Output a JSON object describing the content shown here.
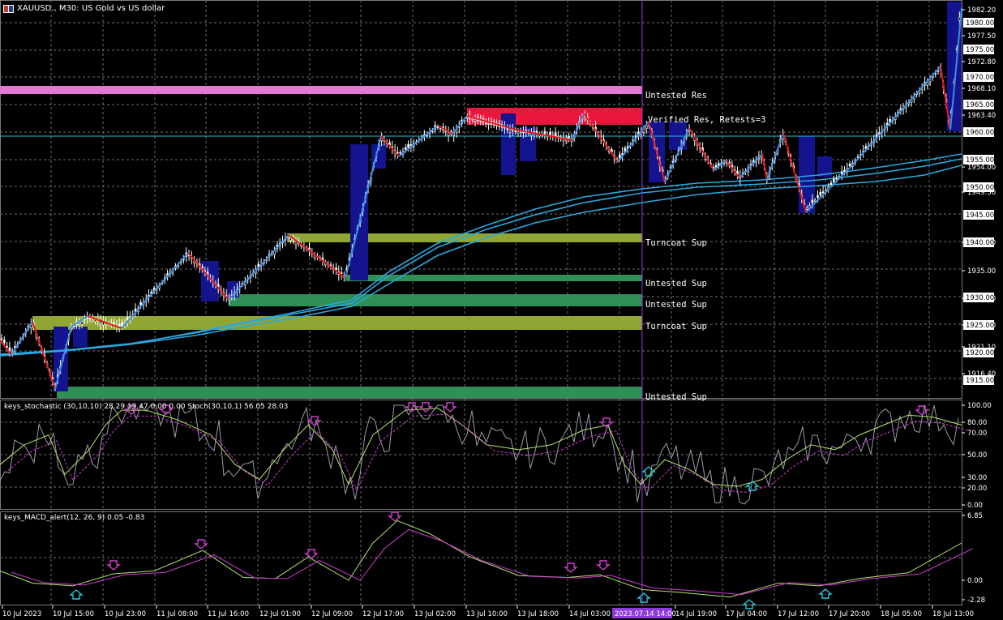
{
  "header": {
    "symbol_info": "XAUUSD., M30:  US Gold vs US dollar",
    "stoch_info": "keys_stochastic (30,10,10) 28.29 19.47 0.00 0.00 Stoch(30,10,1) 56.05 28.03",
    "macd_info": "keys_MACD_alert(12, 26, 9) 0.05 -0.83"
  },
  "zones": {
    "untested_res": "Untested Res",
    "verified_res": "Verified Res, Retests=3",
    "turncoat_sup_1": "Turncoat Sup",
    "untested_sup_1": "Untested Sup",
    "untested_sup_2": "Untested Sup",
    "turncoat_sup_2": "Turncoat Sup",
    "untested_sup_3": "Untested Sup"
  },
  "price_axis": {
    "labels": [
      "1982.20",
      "1977.50",
      "1972.80",
      "1968.10",
      "1963.40",
      "1954.00",
      "1949.30",
      "1940.00",
      "1935.00",
      "1930.00",
      "1925.00",
      "1921.10",
      "1916.40"
    ],
    "boxed": [
      {
        "value": "1980.00",
        "style": "white"
      },
      {
        "value": "1975.00",
        "style": "white"
      },
      {
        "value": "1970.00",
        "style": "white"
      },
      {
        "value": "1965.00",
        "style": "white"
      },
      {
        "value": "1960.00",
        "style": "white"
      },
      {
        "value": "1955.00",
        "style": "white"
      },
      {
        "value": "1950.00",
        "style": "white"
      },
      {
        "value": "1945.00",
        "style": "white"
      },
      {
        "value": "1940.00",
        "style": "white"
      },
      {
        "value": "1930.00",
        "style": "white"
      },
      {
        "value": "1925.00",
        "style": "white"
      },
      {
        "value": "1920.00",
        "style": "white"
      },
      {
        "value": "1915.00",
        "style": "white"
      }
    ]
  },
  "stoch_axis": [
    "100.00",
    "80.00",
    "70.00",
    "50.00",
    "30.00",
    "20.00",
    "0.00"
  ],
  "macd_axis": [
    "6.85",
    "0.00",
    "-2.28"
  ],
  "time_axis": [
    "10 Jul 2023",
    "10 Jul 15:00",
    "10 Jul 23:00",
    "11 Jul 08:00",
    "11 Jul 16:00",
    "12 Jul 01:00",
    "12 Jul 09:00",
    "12 Jul 17:00",
    "13 Jul 02:00",
    "13 Jul 10:00",
    "13 Jul 18:00",
    "14 Jul 03:00",
    "14 Jul 19:00",
    "17 Jul 04:00",
    "17 Jul 12:00",
    "17 Jul 20:00",
    "18 Jul 05:00",
    "18 Jul 13:00"
  ],
  "crosshair_time": "2023.07.14 14:00",
  "colors": {
    "background": "#000000",
    "grid": "#8a8a8a",
    "bull_candle": "#ffffff",
    "bear_candle": "#ffffff",
    "zigzag_up": "#3a8ee6",
    "zigzag_down": "#e41b1b",
    "ema": "#2aa8e0",
    "res_zone_untested": "#e07ad2",
    "res_zone_verified": "#e8173c",
    "turncoat_zone": "#8fa635",
    "sup_zone": "#2f8f57",
    "crosshair": "#8c3bd9",
    "hline": "#1ec4d8",
    "arrow_down": "#d13cd1",
    "arrow_up": "#22c8d8"
  }
}
